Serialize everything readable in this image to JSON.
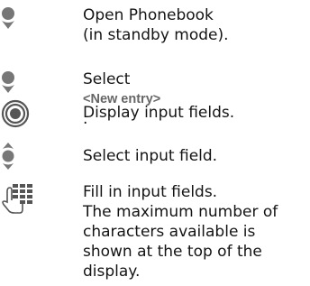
{
  "steps": [
    {
      "icon": "nav-down-icon",
      "lines": [
        "Open Phonebook",
        "(in standby mode)."
      ]
    },
    {
      "icon": "nav-down-icon",
      "text_before": "Select ",
      "ui_term": "<New entry>",
      "text_after": "."
    },
    {
      "icon": "center-select-icon",
      "lines": [
        "Display input fields."
      ]
    },
    {
      "icon": "nav-up-down-icon",
      "lines": [
        "Select input field."
      ]
    },
    {
      "icon": "keypad-icon",
      "lines": [
        "Fill in input fields.",
        "The maximum number of",
        "characters available is",
        "shown at the top of the",
        "display."
      ]
    }
  ],
  "colors": {
    "icon_gray": "#777777",
    "icon_dark": "#555555",
    "ui_term_gray": "#666666",
    "text": "#141414"
  }
}
